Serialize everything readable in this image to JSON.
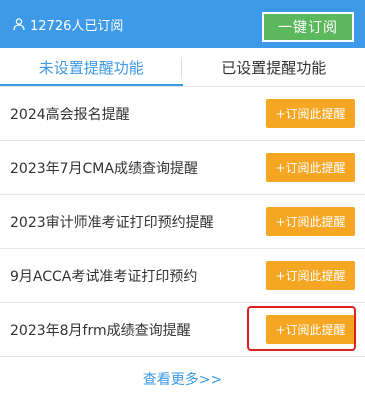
{
  "header": {
    "subscriber_count": "12726人已订阅",
    "subscribe_all_label": "一键订阅",
    "icon": "user-icon"
  },
  "tabs": [
    {
      "label": "未设置提醒功能",
      "active": true
    },
    {
      "label": "已设置提醒功能",
      "active": false
    }
  ],
  "reminders": [
    {
      "title": "2024高会报名提醒",
      "button": "+订阅此提醒"
    },
    {
      "title": "2023年7月CMA成绩查询提醒",
      "button": "+订阅此提醒"
    },
    {
      "title": "2023审计师准考证打印预约提醒",
      "button": "+订阅此提醒"
    },
    {
      "title": "9月ACCA考试准考证打印预约",
      "button": "+订阅此提醒"
    },
    {
      "title": "2023年8月frm成绩查询提醒",
      "button": "+订阅此提醒"
    }
  ],
  "more_label": "查看更多>>",
  "colors": {
    "primary": "#3d9ae8",
    "subscribe_all": "#5cb85c",
    "subscribe_button": "#f5a623",
    "highlight": "#e02020"
  }
}
